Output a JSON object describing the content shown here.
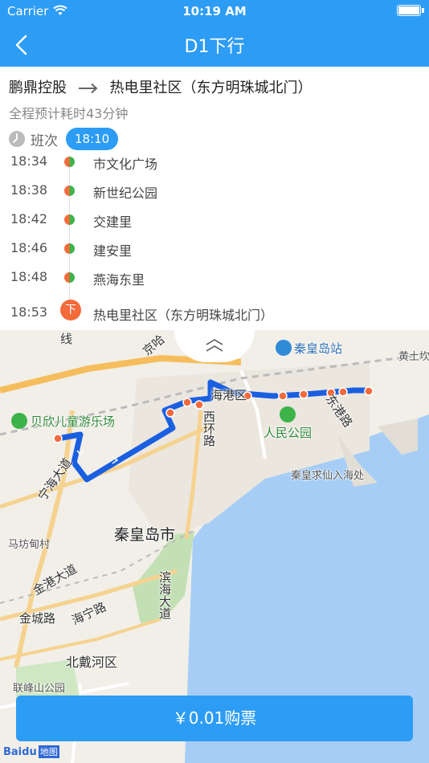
{
  "status_bar": {
    "carrier": "Carrier",
    "time": "10:19 AM"
  },
  "nav": {
    "title": "D1下行"
  },
  "route": {
    "from": "鹏鼎控股",
    "to": "热电里社区（东方明珠城北门）",
    "duration": "全程预计耗时43分钟",
    "schedule_label": "班次",
    "selected_time": "18:10"
  },
  "stops": [
    {
      "time": "18:34",
      "name": "市文化广场"
    },
    {
      "time": "18:38",
      "name": "新世纪公园"
    },
    {
      "time": "18:42",
      "name": "交建里"
    },
    {
      "time": "18:46",
      "name": "建安里"
    },
    {
      "time": "18:48",
      "name": "燕海东里"
    },
    {
      "time": "18:53",
      "name": "热电里社区（东方明珠城北门）",
      "badge": "下"
    }
  ],
  "map": {
    "labels": {
      "xian": "线",
      "jingha": "京哈",
      "qinhuangdao_station": "秦皇岛站",
      "huangtukan": "黄土坎",
      "beixin_park": "贝欣儿童游乐场",
      "haigang": "海港区",
      "xihuan": "西环路",
      "donggang": "东港路",
      "renmin_park": "人民公园",
      "qiuxian": "秦皇求仙入海处",
      "ninghai": "宁海大道",
      "city": "秦皇岛市",
      "mafangdian": "马坊甸村",
      "binhai": "滨海大道",
      "jingang": "金港大道",
      "jincheng": "金城路",
      "haining": "海宁路",
      "beidaihe": "北戴河区",
      "lianfengshan": "联峰山公园"
    },
    "brand": "Baidu",
    "brand_map": "地图"
  },
  "buy_button": {
    "label": "￥0.01购票"
  },
  "colors": {
    "accent": "#2d9cf4",
    "route": "#1a5fe0",
    "arrive": "#f46a3b",
    "stop_green": "#3db34a"
  }
}
